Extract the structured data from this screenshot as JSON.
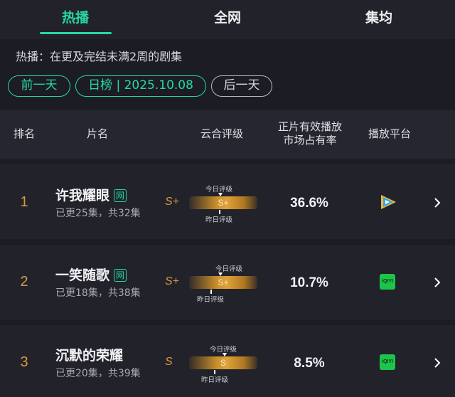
{
  "tabs": [
    {
      "label": "热播",
      "active": true
    },
    {
      "label": "全网",
      "active": false
    },
    {
      "label": "集均",
      "active": false
    }
  ],
  "description": "热播：在更及完结未满2周的剧集",
  "date_nav": {
    "prev": "前一天",
    "current": "日榜 | 2025.10.08",
    "next": "后一天"
  },
  "table": {
    "headers": {
      "rank": "排名",
      "title": "片名",
      "rating": "云合评级",
      "share": "正片有效播放市场占有率",
      "platform": "播放平台"
    },
    "rating_labels": {
      "today": "今日评级",
      "yesterday": "昨日评级"
    },
    "rows": [
      {
        "rank": "1",
        "title": "许我耀眼",
        "badge": "网",
        "episodes": "已更25集，共32集",
        "grade": "S+",
        "bar_grade": "S+",
        "share": "36.6%",
        "platform": "tencent-video-icon"
      },
      {
        "rank": "2",
        "title": "一笑随歌",
        "badge": "网",
        "episodes": "已更18集，共38集",
        "grade": "S+",
        "bar_grade": "S+",
        "share": "10.7%",
        "platform": "iqiyi-icon",
        "platform_text": "iQIYI"
      },
      {
        "rank": "3",
        "title": "沉默的荣耀",
        "badge": "",
        "episodes": "已更20集，共39集",
        "grade": "S",
        "bar_grade": "S",
        "share": "8.5%",
        "platform": "iqiyi-icon",
        "platform_text": "iQIYI"
      }
    ]
  },
  "colors": {
    "accent": "#27d8a4",
    "grade": "#d99a3e",
    "background": "#1c1c24"
  }
}
